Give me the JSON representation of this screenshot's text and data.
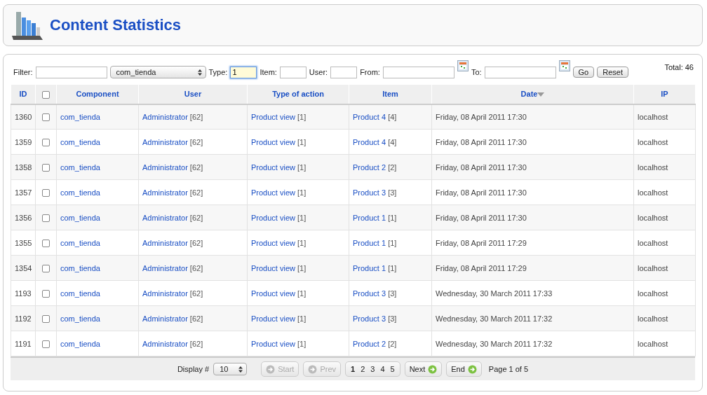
{
  "header": {
    "title": "Content Statistics"
  },
  "filters": {
    "filter_label": "Filter:",
    "component_select": "com_tienda",
    "type_label": "Type:",
    "type_value": "1",
    "item_label": "Item:",
    "user_label": "User:",
    "from_label": "From:",
    "to_label": "To:",
    "go": "Go",
    "reset": "Reset",
    "total": "Total: 46"
  },
  "table": {
    "columns": [
      {
        "label": "ID",
        "sorted": false
      },
      {
        "kind": "checkbox",
        "sorted": false
      },
      {
        "label": "Component",
        "sorted": false
      },
      {
        "label": "User",
        "sorted": false
      },
      {
        "label": "Type of action",
        "sorted": false
      },
      {
        "label": "Item",
        "sorted": false
      },
      {
        "label": "Date",
        "sorted": true
      },
      {
        "label": "IP",
        "sorted": false
      }
    ],
    "rows": [
      {
        "id": "1360",
        "checked": false,
        "component": "com_tienda",
        "user": "Administrator",
        "user_ref": "[62]",
        "action": "Product view",
        "action_ref": "[1]",
        "item": "Product 4",
        "item_ref": "[4]",
        "date": "Friday, 08 April 2011 17:30",
        "ip": "localhost"
      },
      {
        "id": "1359",
        "checked": false,
        "component": "com_tienda",
        "user": "Administrator",
        "user_ref": "[62]",
        "action": "Product view",
        "action_ref": "[1]",
        "item": "Product 4",
        "item_ref": "[4]",
        "date": "Friday, 08 April 2011 17:30",
        "ip": "localhost"
      },
      {
        "id": "1358",
        "checked": false,
        "component": "com_tienda",
        "user": "Administrator",
        "user_ref": "[62]",
        "action": "Product view",
        "action_ref": "[1]",
        "item": "Product 2",
        "item_ref": "[2]",
        "date": "Friday, 08 April 2011 17:30",
        "ip": "localhost"
      },
      {
        "id": "1357",
        "checked": false,
        "component": "com_tienda",
        "user": "Administrator",
        "user_ref": "[62]",
        "action": "Product view",
        "action_ref": "[1]",
        "item": "Product 3",
        "item_ref": "[3]",
        "date": "Friday, 08 April 2011 17:30",
        "ip": "localhost"
      },
      {
        "id": "1356",
        "checked": false,
        "component": "com_tienda",
        "user": "Administrator",
        "user_ref": "[62]",
        "action": "Product view",
        "action_ref": "[1]",
        "item": "Product 1",
        "item_ref": "[1]",
        "date": "Friday, 08 April 2011 17:30",
        "ip": "localhost"
      },
      {
        "id": "1355",
        "checked": false,
        "component": "com_tienda",
        "user": "Administrator",
        "user_ref": "[62]",
        "action": "Product view",
        "action_ref": "[1]",
        "item": "Product 1",
        "item_ref": "[1]",
        "date": "Friday, 08 April 2011 17:29",
        "ip": "localhost"
      },
      {
        "id": "1354",
        "checked": false,
        "component": "com_tienda",
        "user": "Administrator",
        "user_ref": "[62]",
        "action": "Product view",
        "action_ref": "[1]",
        "item": "Product 1",
        "item_ref": "[1]",
        "date": "Friday, 08 April 2011 17:29",
        "ip": "localhost"
      },
      {
        "id": "1193",
        "checked": false,
        "component": "com_tienda",
        "user": "Administrator",
        "user_ref": "[62]",
        "action": "Product view",
        "action_ref": "[1]",
        "item": "Product 3",
        "item_ref": "[3]",
        "date": "Wednesday, 30 March 2011 17:33",
        "ip": "localhost"
      },
      {
        "id": "1192",
        "checked": false,
        "component": "com_tienda",
        "user": "Administrator",
        "user_ref": "[62]",
        "action": "Product view",
        "action_ref": "[1]",
        "item": "Product 3",
        "item_ref": "[3]",
        "date": "Wednesday, 30 March 2011 17:32",
        "ip": "localhost"
      },
      {
        "id": "1191",
        "checked": false,
        "component": "com_tienda",
        "user": "Administrator",
        "user_ref": "[62]",
        "action": "Product view",
        "action_ref": "[1]",
        "item": "Product 2",
        "item_ref": "[2]",
        "date": "Wednesday, 30 March 2011 17:32",
        "ip": "localhost"
      }
    ]
  },
  "pagination": {
    "display_label": "Display #",
    "display_value": "10",
    "start": {
      "label": "Start",
      "disabled": true
    },
    "prev": {
      "label": "Prev",
      "disabled": true
    },
    "pages": [
      {
        "label": "1",
        "selected": true
      },
      {
        "label": "2",
        "selected": false
      },
      {
        "label": "3",
        "selected": false
      },
      {
        "label": "4",
        "selected": false
      },
      {
        "label": "5",
        "selected": false
      }
    ],
    "next": {
      "label": "Next",
      "disabled": false
    },
    "end": {
      "label": "End",
      "disabled": false
    },
    "page_info": "Page 1 of 5"
  }
}
